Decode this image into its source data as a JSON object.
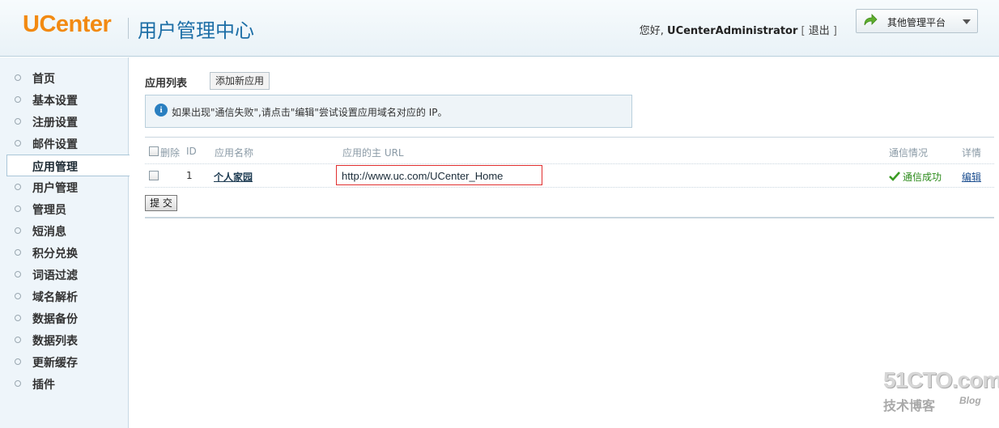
{
  "header": {
    "logo": "UCenter",
    "title": "用户管理中心",
    "greeting_prefix": "您好,",
    "username": "UCenterAdministrator",
    "bracket_open": "[",
    "logout": "退出",
    "bracket_close": "]",
    "platform_label": "其他管理平台"
  },
  "sidebar": {
    "items": [
      {
        "label": "首页"
      },
      {
        "label": "基本设置"
      },
      {
        "label": "注册设置"
      },
      {
        "label": "邮件设置"
      },
      {
        "label": "应用管理",
        "active": true
      },
      {
        "label": "用户管理"
      },
      {
        "label": "管理员"
      },
      {
        "label": "短消息"
      },
      {
        "label": "积分兑换"
      },
      {
        "label": "词语过滤"
      },
      {
        "label": "域名解析"
      },
      {
        "label": "数据备份"
      },
      {
        "label": "数据列表"
      },
      {
        "label": "更新缓存"
      },
      {
        "label": "插件"
      }
    ]
  },
  "main": {
    "list_title": "应用列表",
    "add_button": "添加新应用",
    "notice": "如果出现\"通信失败\",请点击\"编辑\"尝试设置应用域名对应的 IP。",
    "columns": {
      "delete": "删除",
      "id": "ID",
      "name": "应用名称",
      "url": "应用的主 URL",
      "status": "通信情况",
      "detail": "详情"
    },
    "rows": [
      {
        "id": "1",
        "name": "个人家园",
        "url": "http://www.uc.com/UCenter_Home",
        "status": "通信成功",
        "detail": "编辑"
      }
    ],
    "submit": "提 交"
  },
  "watermark": {
    "site": "51CTO.com",
    "sub": "技术博客",
    "blog": "Blog"
  },
  "colors": {
    "accent": "#1c6ea6",
    "logo": "#f28a12",
    "success": "#2b8a1a",
    "highlight_border": "#e03030"
  }
}
